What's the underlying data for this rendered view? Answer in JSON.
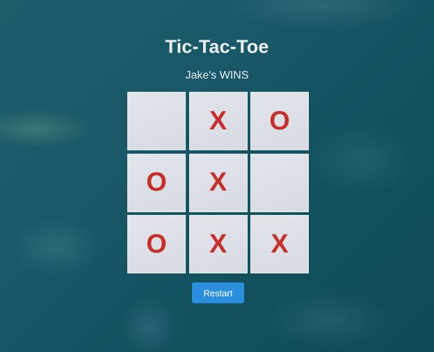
{
  "game": {
    "title": "Tic-Tac-Toe",
    "status": "Jake's WINS",
    "board": [
      "",
      "X",
      "O",
      "O",
      "X",
      "",
      "O",
      "X",
      "X"
    ],
    "restart_label": "Restart",
    "mark_color": "#c62f2c",
    "button_color": "#2b8fde"
  }
}
